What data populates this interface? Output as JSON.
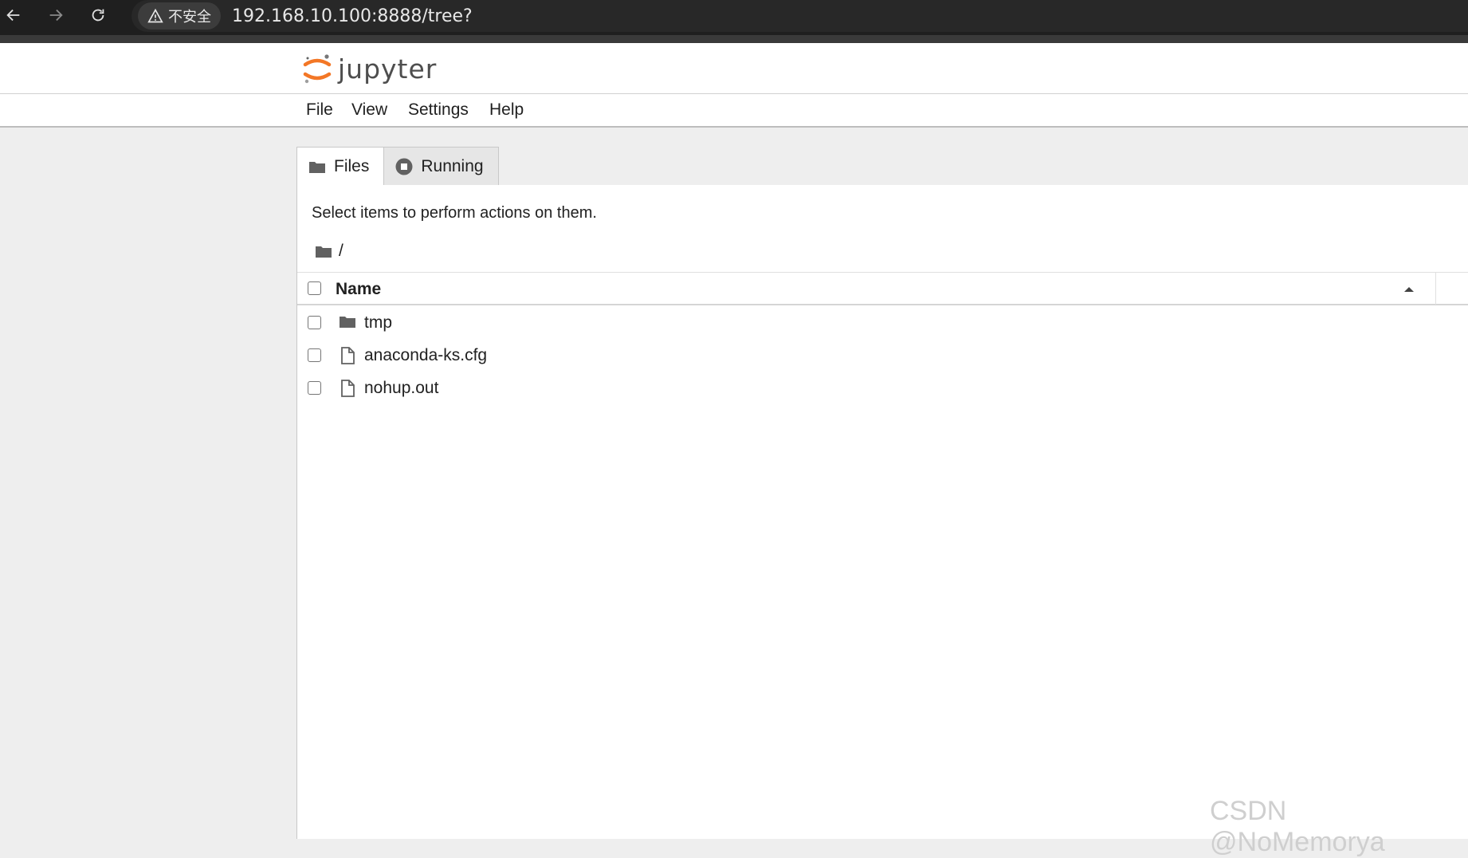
{
  "browser": {
    "security_label": "不安全",
    "url": "192.168.10.100:8888/tree?"
  },
  "header": {
    "logo_text": "jupyter"
  },
  "menu": {
    "file": "File",
    "view": "View",
    "settings": "Settings",
    "help": "Help"
  },
  "tabs": {
    "files": "Files",
    "running": "Running"
  },
  "browser_panel": {
    "instructions": "Select items to perform actions on them.",
    "breadcrumb": "/",
    "column_name": "Name",
    "items": [
      {
        "name": "tmp",
        "type": "folder"
      },
      {
        "name": "anaconda-ks.cfg",
        "type": "file"
      },
      {
        "name": "nohup.out",
        "type": "file"
      }
    ]
  },
  "watermark": "CSDN @NoMemorya",
  "colors": {
    "jupyter_orange": "#F37726",
    "chrome_dark": "#1f1f1f"
  }
}
